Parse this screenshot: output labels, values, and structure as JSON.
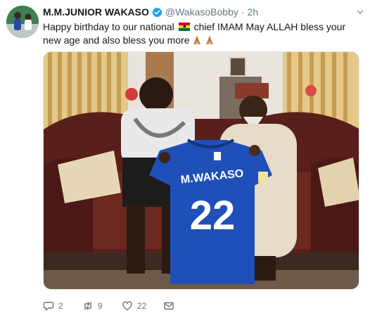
{
  "tweet": {
    "display_name": "M.M.JUNIOR WAKASO",
    "handle": "@WakasoBobby",
    "separator": "·",
    "timestamp": "2h",
    "text_part1": "Happy birthday to our national",
    "text_part2": "chief IMAM May ALLAH bless your new age and also bless you more",
    "flag_icon": "ghana-flag-icon",
    "emoji": "folded-hands-icon",
    "jersey_name": "M.WAKASO",
    "jersey_number": "22"
  },
  "actions": {
    "reply_count": "2",
    "retweet_count": "9",
    "like_count": "22"
  },
  "colors": {
    "verified": "#1da1f2",
    "secondary_text": "#657786",
    "jersey_blue": "#1f4fb8",
    "ghana_red": "#ce1126",
    "ghana_gold": "#fcd116",
    "ghana_green": "#006b3f"
  }
}
